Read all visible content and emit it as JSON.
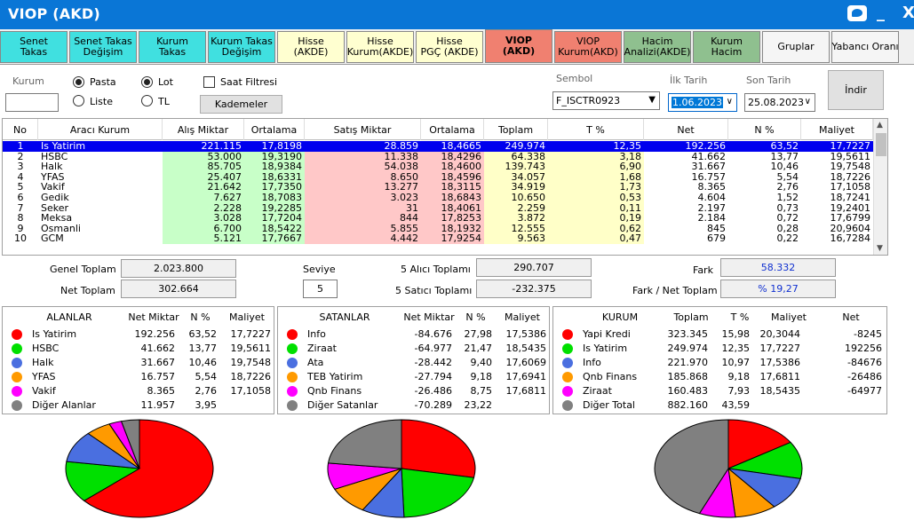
{
  "window": {
    "title": "VIOP (AKD)",
    "minimize_label": "_",
    "close_label": "X"
  },
  "colors": {
    "red": "#ff0000",
    "green": "#00e000",
    "blue": "#4a6fe0",
    "orange": "#ff9a00",
    "magenta": "#ff00ff",
    "gray": "#808080"
  },
  "tabs": [
    {
      "label": "Senet\nTakas",
      "bg": "#40e0e0",
      "active": false
    },
    {
      "label": "Senet Takas\nDeğişim",
      "bg": "#40e0e0",
      "active": false
    },
    {
      "label": "Kurum\nTakas",
      "bg": "#40e0e0",
      "active": false
    },
    {
      "label": "Kurum Takas\nDeğişim",
      "bg": "#40e0e0",
      "active": false
    },
    {
      "label": "Hisse\n(AKDE)",
      "bg": "#ffffd0",
      "active": false
    },
    {
      "label": "Hisse\nKurum(AKDE)",
      "bg": "#ffffd0",
      "active": false
    },
    {
      "label": "Hisse\nPGÇ (AKDE)",
      "bg": "#ffffd0",
      "active": false
    },
    {
      "label": "VIOP\n(AKD)",
      "bg": "#f08070",
      "active": true
    },
    {
      "label": "VIOP\nKurum(AKD)",
      "bg": "#f08070",
      "active": false
    },
    {
      "label": "Hacim\nAnalizi(AKDE)",
      "bg": "#8fc08f",
      "active": false
    },
    {
      "label": "Kurum\nHacim",
      "bg": "#8fc08f",
      "active": false
    },
    {
      "label": "Gruplar",
      "bg": "#f5f5f5",
      "active": false
    },
    {
      "label": "Yabancı Oranı",
      "bg": "#f5f5f5",
      "active": false
    }
  ],
  "filters": {
    "kurum_label": "Kurum",
    "kurum_value": "",
    "pasta_label": "Pasta",
    "liste_label": "Liste",
    "lot_label": "Lot",
    "tl_label": "TL",
    "saat_filtresi_label": "Saat Filtresi",
    "kademeler_label": "Kademeler",
    "sembol_label": "Sembol",
    "sembol_value": "F_ISCTR0923",
    "ilk_tarih_label": "İlk Tarih",
    "ilk_tarih_value": "1.06.2023",
    "son_tarih_label": "Son Tarih",
    "son_tarih_value": "25.08.2023",
    "indir_label": "İndir"
  },
  "grid": {
    "headers": [
      "No",
      "Aracı Kurum",
      "Alış Miktar",
      "Ortalama",
      "Satış Miktar",
      "Ortalama",
      "Toplam",
      "T %",
      "Net",
      "N %",
      "Maliyet"
    ],
    "rows": [
      [
        "1",
        "Is Yatirim",
        "221.115",
        "17,8198",
        "28.859",
        "18,4665",
        "249.974",
        "12,35",
        "192.256",
        "63,52",
        "17,7227"
      ],
      [
        "2",
        "HSBC",
        "53.000",
        "19,3190",
        "11.338",
        "18,4296",
        "64.338",
        "3,18",
        "41.662",
        "13,77",
        "19,5611"
      ],
      [
        "3",
        "Halk",
        "85.705",
        "18,9384",
        "54.038",
        "18,4600",
        "139.743",
        "6,90",
        "31.667",
        "10,46",
        "19,7548"
      ],
      [
        "4",
        "YFAS",
        "25.407",
        "18,6331",
        "8.650",
        "18,4596",
        "34.057",
        "1,68",
        "16.757",
        "5,54",
        "18,7226"
      ],
      [
        "5",
        "Vakif",
        "21.642",
        "17,7350",
        "13.277",
        "18,3115",
        "34.919",
        "1,73",
        "8.365",
        "2,76",
        "17,1058"
      ],
      [
        "6",
        "Gedik",
        "7.627",
        "18,7083",
        "3.023",
        "18,6843",
        "10.650",
        "0,53",
        "4.604",
        "1,52",
        "18,7241"
      ],
      [
        "7",
        "Seker",
        "2.228",
        "19,2285",
        "31",
        "18,4061",
        "2.259",
        "0,11",
        "2.197",
        "0,73",
        "19,2401"
      ],
      [
        "8",
        "Meksa",
        "3.028",
        "17,7204",
        "844",
        "17,8253",
        "3.872",
        "0,19",
        "2.184",
        "0,72",
        "17,6799"
      ],
      [
        "9",
        "Osmanli",
        "6.700",
        "18,5422",
        "5.855",
        "18,1932",
        "12.555",
        "0,62",
        "845",
        "0,28",
        "20,9604"
      ],
      [
        "10",
        "GCM",
        "5.121",
        "17,7667",
        "4.442",
        "17,9254",
        "9.563",
        "0,47",
        "679",
        "0,22",
        "16,7284"
      ]
    ]
  },
  "summary": {
    "genel_toplam_label": "Genel Toplam",
    "genel_toplam_value": "2.023.800",
    "net_toplam_label": "Net Toplam",
    "net_toplam_value": "302.664",
    "seviye_label": "Seviye",
    "seviye_value": "5",
    "alici_label": "5  Alıcı Toplamı",
    "alici_value": "290.707",
    "satici_label": "5  Satıcı Toplamı",
    "satici_value": "-232.375",
    "fark_label": "Fark",
    "fark_value": "58.332",
    "fark_net_label": "Fark / Net Toplam",
    "fark_net_value": "% 19,27"
  },
  "alanlar": {
    "headers": [
      "ALANLAR",
      "Net Miktar",
      "N %",
      "Maliyet"
    ],
    "rows": [
      {
        "color": "red",
        "name": "Is Yatirim",
        "net": "192.256",
        "n": "63,52",
        "maliyet": "17,7227",
        "pct": 63.52
      },
      {
        "color": "green",
        "name": "HSBC",
        "net": "41.662",
        "n": "13,77",
        "maliyet": "19,5611",
        "pct": 13.77
      },
      {
        "color": "blue",
        "name": "Halk",
        "net": "31.667",
        "n": "10,46",
        "maliyet": "19,7548",
        "pct": 10.46
      },
      {
        "color": "orange",
        "name": "YFAS",
        "net": "16.757",
        "n": "5,54",
        "maliyet": "18,7226",
        "pct": 5.54
      },
      {
        "color": "magenta",
        "name": "Vakif",
        "net": "8.365",
        "n": "2,76",
        "maliyet": "17,1058",
        "pct": 2.76
      },
      {
        "color": "gray",
        "name": "Diğer Alanlar",
        "net": "11.957",
        "n": "3,95",
        "maliyet": "",
        "pct": 3.95
      }
    ]
  },
  "satanlar": {
    "headers": [
      "SATANLAR",
      "Net Miktar",
      "N %",
      "Maliyet"
    ],
    "rows": [
      {
        "color": "red",
        "name": "Info",
        "net": "-84.676",
        "n": "27,98",
        "maliyet": "17,5386",
        "pct": 27.98
      },
      {
        "color": "green",
        "name": "Ziraat",
        "net": "-64.977",
        "n": "21,47",
        "maliyet": "18,5435",
        "pct": 21.47
      },
      {
        "color": "blue",
        "name": "Ata",
        "net": "-28.442",
        "n": "9,40",
        "maliyet": "17,6069",
        "pct": 9.4
      },
      {
        "color": "orange",
        "name": "TEB Yatirim",
        "net": "-27.794",
        "n": "9,18",
        "maliyet": "17,6941",
        "pct": 9.18
      },
      {
        "color": "magenta",
        "name": "Qnb Finans",
        "net": "-26.486",
        "n": "8,75",
        "maliyet": "17,6811",
        "pct": 8.75
      },
      {
        "color": "gray",
        "name": "Diğer Satanlar",
        "net": "-70.289",
        "n": "23,22",
        "maliyet": "",
        "pct": 23.22
      }
    ]
  },
  "kurum": {
    "headers": [
      "KURUM",
      "Toplam",
      "T %",
      "Maliyet",
      "Net"
    ],
    "rows": [
      {
        "color": "red",
        "name": "Yapi Kredi",
        "toplam": "323.345",
        "t": "15,98",
        "maliyet": "20,3044",
        "net": "-8245",
        "pct": 15.98
      },
      {
        "color": "green",
        "name": "Is Yatirim",
        "toplam": "249.974",
        "t": "12,35",
        "maliyet": "17,7227",
        "net": "192256",
        "pct": 12.35
      },
      {
        "color": "blue",
        "name": "Info",
        "toplam": "221.970",
        "t": "10,97",
        "maliyet": "17,5386",
        "net": "-84676",
        "pct": 10.97
      },
      {
        "color": "orange",
        "name": "Qnb Finans",
        "toplam": "185.868",
        "t": "9,18",
        "maliyet": "17,6811",
        "net": "-26486",
        "pct": 9.18
      },
      {
        "color": "magenta",
        "name": "Ziraat",
        "toplam": "160.483",
        "t": "7,93",
        "maliyet": "18,5435",
        "net": "-64977",
        "pct": 7.93
      },
      {
        "color": "gray",
        "name": "Diğer Total",
        "toplam": "882.160",
        "t": "43,59",
        "maliyet": "",
        "net": "",
        "pct": 43.59
      }
    ]
  }
}
